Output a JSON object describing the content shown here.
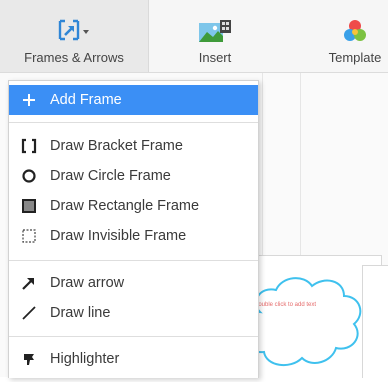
{
  "toolbar": {
    "frames_arrows_label": "Frames & Arrows",
    "insert_label": "Insert",
    "template_label": "Template"
  },
  "menu": {
    "add_frame": "Add Frame",
    "draw_bracket_frame": "Draw Bracket Frame",
    "draw_circle_frame": "Draw Circle Frame",
    "draw_rectangle_frame": "Draw Rectangle Frame",
    "draw_invisible_frame": "Draw Invisible Frame",
    "draw_arrow": "Draw arrow",
    "draw_line": "Draw line",
    "highlighter": "Highlighter"
  },
  "canvas": {
    "cloud_hint": "Double click to add text"
  },
  "colors": {
    "accent": "#3b8ff5",
    "cloud_stroke": "#3fc1ee",
    "hint_text": "#e56b6b"
  }
}
